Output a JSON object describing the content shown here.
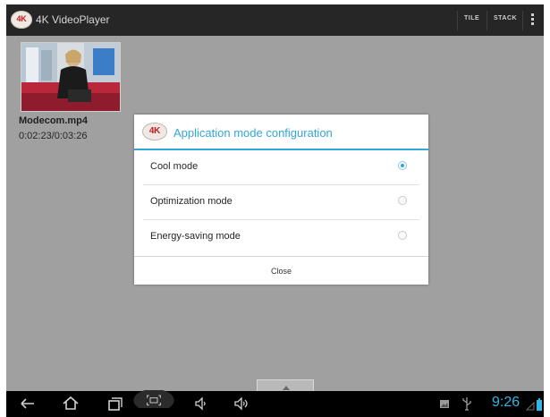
{
  "app": {
    "title": "4K VideoPlayer",
    "logo_text": "4K",
    "action_buttons": [
      "TILE",
      "STACK"
    ]
  },
  "video": {
    "name": "Modecom.mp4",
    "time": "0:02:23/0:03:26"
  },
  "dialog": {
    "logo_text": "4K",
    "title": "Application mode configuration",
    "options": [
      {
        "label": "Cool mode",
        "selected": true
      },
      {
        "label": "Optimization mode",
        "selected": false
      },
      {
        "label": "Energy-saving mode",
        "selected": false
      }
    ],
    "close_label": "Close"
  },
  "status": {
    "clock": "9:26"
  },
  "colors": {
    "accent": "#33a6d6",
    "action_bar": "#262626",
    "content_bg": "#a0a0a0",
    "navbar": "#000000"
  },
  "icons": [
    "back-icon",
    "home-icon",
    "recent-apps-icon",
    "screenshot-icon",
    "volume-down-icon",
    "volume-up-icon",
    "gallery-icon",
    "usb-icon",
    "wifi-icon",
    "battery-icon",
    "overflow-menu-icon",
    "expand-handle-icon"
  ]
}
